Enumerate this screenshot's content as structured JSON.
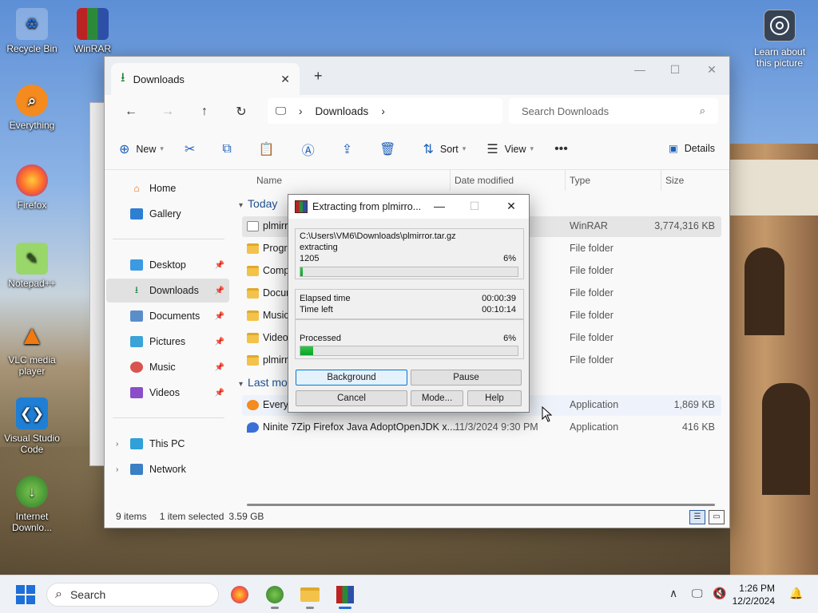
{
  "desktop": {
    "icons": [
      {
        "label": "Recycle Bin",
        "icon": "recycle-bin-icon"
      },
      {
        "label": "WinRAR",
        "icon": "winrar-icon"
      },
      {
        "label": "Everything",
        "icon": "everything-icon"
      },
      {
        "label": "Firefox",
        "icon": "firefox-icon"
      },
      {
        "label": "Notepad++",
        "icon": "notepad-plus-plus-icon"
      },
      {
        "label": "VLC media player",
        "icon": "vlc-icon"
      },
      {
        "label": "Visual Studio Code",
        "icon": "vscode-icon"
      },
      {
        "label": "Internet Downlo...",
        "icon": "internet-download-manager-icon"
      }
    ],
    "learn_label": "Learn about this picture"
  },
  "explorer": {
    "tab_title": "Downloads",
    "address": {
      "segment": "Downloads"
    },
    "search_placeholder": "Search Downloads",
    "commands": {
      "new": "New",
      "sort": "Sort",
      "view": "View",
      "details": "Details"
    },
    "sidebar": {
      "home": "Home",
      "gallery": "Gallery",
      "desktop": "Desktop",
      "downloads": "Downloads",
      "documents": "Documents",
      "pictures": "Pictures",
      "music": "Music",
      "videos": "Videos",
      "this_pc": "This PC",
      "network": "Network"
    },
    "columns": {
      "name": "Name",
      "date": "Date modified",
      "type": "Type",
      "size": "Size"
    },
    "groups": {
      "today": "Today",
      "last_month": "Last mo"
    },
    "rows_today": [
      {
        "name": "plmirr",
        "date": "",
        "type": "WinRAR",
        "size": "3,774,316 KB",
        "kind": "archive"
      },
      {
        "name": "Progra",
        "date": "",
        "type": "File folder",
        "size": "",
        "kind": "folder"
      },
      {
        "name": "Comp",
        "date": "",
        "type": "File folder",
        "size": "",
        "kind": "folder"
      },
      {
        "name": "Docur",
        "date": "",
        "type": "File folder",
        "size": "",
        "kind": "folder"
      },
      {
        "name": "Music",
        "date": "",
        "type": "File folder",
        "size": "",
        "kind": "folder"
      },
      {
        "name": "Video",
        "date": "",
        "type": "File folder",
        "size": "",
        "kind": "folder"
      },
      {
        "name": "plmirr",
        "date": "",
        "type": "File folder",
        "size": "",
        "kind": "folder"
      }
    ],
    "rows_last_month": [
      {
        "name": "Everyt",
        "date": "",
        "type": "Application",
        "size": "1,869 KB",
        "kind": "everything"
      },
      {
        "name": "Ninite 7Zip Firefox Java AdoptOpenJDK x...",
        "date": "11/3/2024 9:30 PM",
        "type": "Application",
        "size": "416 KB",
        "kind": "ninite"
      }
    ],
    "status": {
      "items": "9 items",
      "selected": "1 item selected",
      "size": "3.59 GB"
    }
  },
  "dialog": {
    "title": "Extracting from plmirro...",
    "path": "C:\\Users\\VM6\\Downloads\\plmirror.tar.gz",
    "action": "extracting",
    "file_label": "1205",
    "file_percent": "6%",
    "file_progress": 0.01,
    "elapsed_label": "Elapsed time",
    "elapsed_value": "00:00:39",
    "left_label": "Time left",
    "left_value": "00:10:14",
    "processed_label": "Processed",
    "processed_percent": "6%",
    "processed_progress": 0.06,
    "buttons": {
      "background": "Background",
      "pause": "Pause",
      "cancel": "Cancel",
      "mode": "Mode...",
      "help": "Help"
    }
  },
  "taskbar": {
    "search_placeholder": "Search",
    "time": "1:26 PM",
    "date": "12/2/2024"
  },
  "colors": {
    "accent": "#1e6fd9",
    "progress": "#06a52a",
    "folder": "#f2c24b"
  }
}
